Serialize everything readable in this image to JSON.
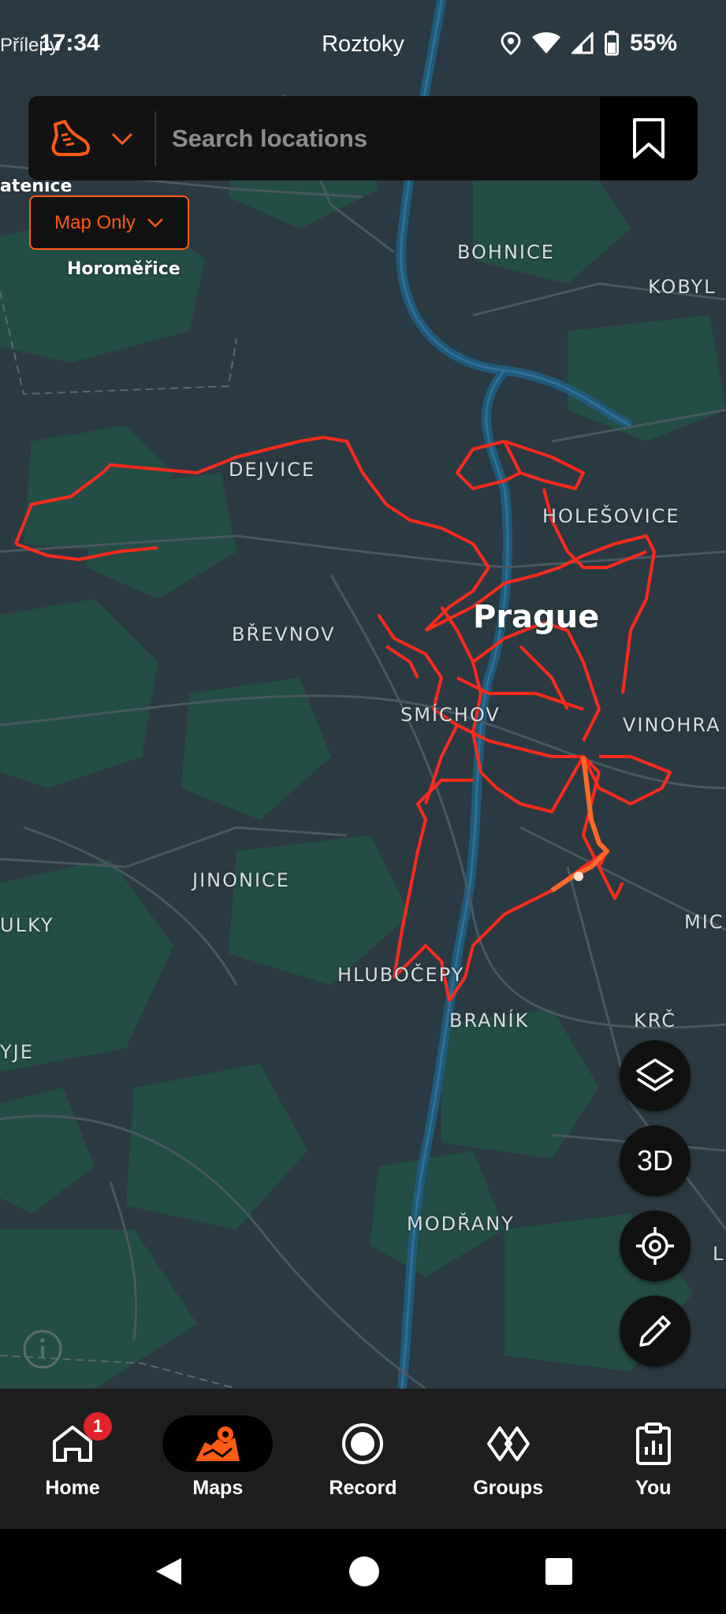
{
  "status_bar": {
    "time": "17:34",
    "location": "Roztoky",
    "overlap_text": "Přílepy",
    "battery": "55%",
    "icons": [
      "location-icon",
      "wifi-icon",
      "signal-icon",
      "battery-icon"
    ]
  },
  "search": {
    "placeholder": "Search locations",
    "sport_icon": "running-shoe-icon",
    "bookmark_icon": "bookmark-icon"
  },
  "map_mode": {
    "label": "Map Only"
  },
  "map_labels": {
    "atenice": "atenice",
    "horomerice": "Horoměřice",
    "bohnice": "BOHNICE",
    "kobyl": "KOBYL",
    "dejvice": "DEJVICE",
    "holesovice": "HOLEŠOVICE",
    "prague": "Prague",
    "brevnov": "BŘEVNOV",
    "smichov": "SMÍCHOV",
    "vinohra": "VINOHRA",
    "jinonice": "JINONICE",
    "ulky": "ULKY",
    "mic": "MIC",
    "hlubocepy": "HLUBOČEPY",
    "branik": "BRANÍK",
    "krc": "KRČ",
    "yje": "YJE",
    "modrany": "MODŘANY",
    "l": "L"
  },
  "map_controls": {
    "layers_icon": "layers-icon",
    "three_d": "3D",
    "locate_icon": "crosshair-icon",
    "draw_icon": "pencil-icon"
  },
  "bottom_nav": {
    "items": [
      {
        "label": "Home",
        "icon": "home-icon",
        "badge": "1"
      },
      {
        "label": "Maps",
        "icon": "maps-icon"
      },
      {
        "label": "Record",
        "icon": "record-icon"
      },
      {
        "label": "Groups",
        "icon": "groups-icon"
      },
      {
        "label": "You",
        "icon": "clipboard-chart-icon"
      }
    ],
    "active": "Maps"
  },
  "colors": {
    "accent": "#ff5b14",
    "heatmap": "#ff2a1a",
    "map_bg": "#2b3a42",
    "green_area": "#235046",
    "river": "#1f5a7a"
  }
}
